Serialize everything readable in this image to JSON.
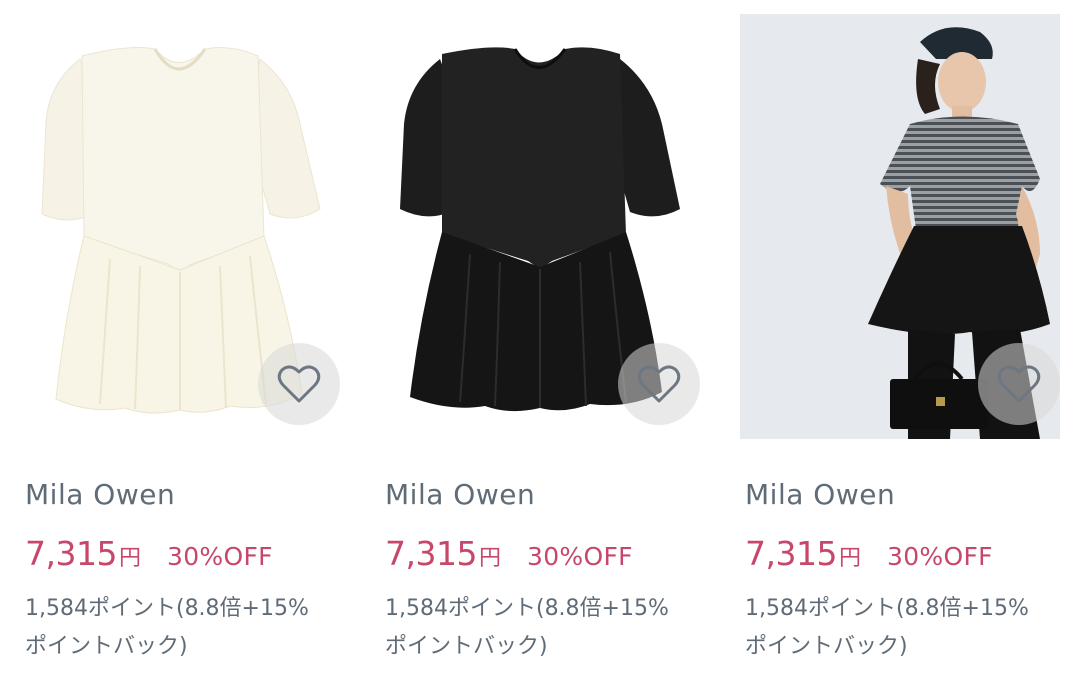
{
  "products": [
    {
      "brand": "Mila Owen",
      "price": "7,315",
      "currency": "円",
      "discount": "30%OFF",
      "points_line1": "1,584ポイント(8.8倍+15%",
      "points_line2": "ポイントバック)",
      "image": "cream-knit-peplum-top"
    },
    {
      "brand": "Mila Owen",
      "price": "7,315",
      "currency": "円",
      "discount": "30%OFF",
      "points_line1": "1,584ポイント(8.8倍+15%",
      "points_line2": "ポイントバック)",
      "image": "black-knit-peplum-top"
    },
    {
      "brand": "Mila Owen",
      "price": "7,315",
      "currency": "円",
      "discount": "30%OFF",
      "points_line1": "1,584ポイント(8.8倍+15%",
      "points_line2": "ポイントバック)",
      "image": "model-striped-peplum-top"
    }
  ],
  "icons": {
    "favorite": "heart-outline-icon"
  },
  "colors": {
    "price": "#c7476a",
    "text_muted": "#5f6b76",
    "fav_bg": "#d7d7d7",
    "photo_bg": "#e6eaee"
  }
}
